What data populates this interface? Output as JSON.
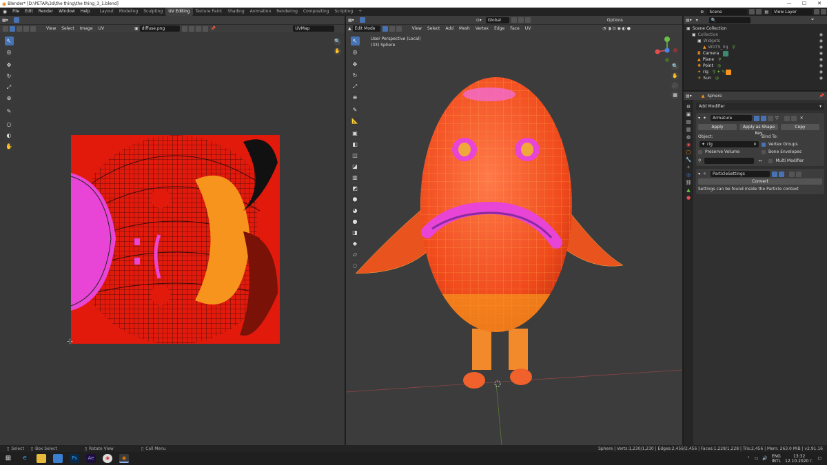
{
  "window": {
    "title": "Blender* [D:\\PETAR\\3d\\the thing\\the thing_3_1.blend]",
    "minimize": "—",
    "maximize": "☐",
    "close": "✕"
  },
  "menu": [
    "File",
    "Edit",
    "Render",
    "Window",
    "Help"
  ],
  "workspaces": [
    {
      "label": "Layout"
    },
    {
      "label": "Modeling"
    },
    {
      "label": "Sculpting"
    },
    {
      "label": "UV Editing",
      "active": true
    },
    {
      "label": "Texture Paint"
    },
    {
      "label": "Shading"
    },
    {
      "label": "Animation"
    },
    {
      "label": "Rendering"
    },
    {
      "label": "Compositing"
    },
    {
      "label": "Scripting"
    },
    {
      "label": "+"
    }
  ],
  "scene": {
    "label": "Scene",
    "view_layer": "View Layer"
  },
  "uv_editor": {
    "menu": [
      "View",
      "Select",
      "Image",
      "UV"
    ],
    "image_name": "diffuse.png",
    "uv_map": "UVMap"
  },
  "viewport": {
    "mode": "Edit Mode",
    "menu": [
      "View",
      "Select",
      "Add",
      "Mesh",
      "Vertex",
      "Edge",
      "Face",
      "UV"
    ],
    "orientation": "Global",
    "options": "Options",
    "info_line1": "User Perspective (Local)",
    "info_line2": "(33) Sphere"
  },
  "outliner": {
    "search_placeholder": "",
    "rows": [
      {
        "label": "Scene Collection",
        "indent": 0
      },
      {
        "label": "Collection",
        "indent": 1
      },
      {
        "label": "Widgets",
        "indent": 2
      },
      {
        "label": "WGTS_rig",
        "indent": 3
      },
      {
        "label": "Camera",
        "indent": 1
      },
      {
        "label": "Plane",
        "indent": 1
      },
      {
        "label": "Point",
        "indent": 1
      },
      {
        "label": "rig",
        "indent": 1
      },
      {
        "label": "Sun",
        "indent": 1
      }
    ]
  },
  "properties": {
    "object_name": "Sphere",
    "add_modifier": "Add Modifier",
    "armature": {
      "name": "Armature",
      "apply": "Apply",
      "apply_shape": "Apply as Shape Key",
      "copy": "Copy",
      "object_label": "Object:",
      "object_value": "rig",
      "bind_to": "Bind To:",
      "vertex_groups": "Vertex Groups",
      "preserve_volume": "Preserve Volume",
      "bone_envelopes": "Bone Envelopes",
      "multi_modifier": "Multi Modifier"
    },
    "particle": {
      "name": "ParticleSettings",
      "convert": "Convert",
      "note": "Settings can be found inside the Particle context"
    }
  },
  "statusbar": {
    "select": "Select",
    "box_select": "Box Select",
    "rotate": "Rotate View",
    "call_menu": "Call Menu",
    "stats": "Sphere | Verts:1,230/1,230 | Edges:2,456/2,456 | Faces:1,228/1,228 | Tris:2,456 | Mem: 263.0 MiB | v2.91.16"
  },
  "taskbar": {
    "lang1": "ENG",
    "lang2": "INTL",
    "time": "13:32",
    "date": "12.10.2020 г."
  },
  "colors": {
    "accent": "#4772b3",
    "texture_red": "#e21a0c",
    "pink": "#e844d6",
    "orange": "#f7941d"
  }
}
